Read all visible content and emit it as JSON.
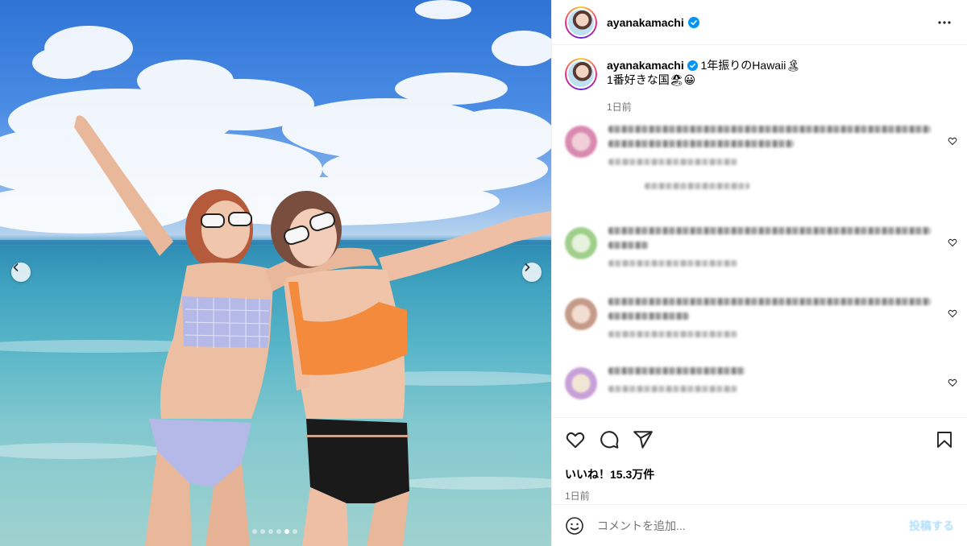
{
  "post": {
    "username": "ayanakamachi",
    "verified": true,
    "caption_line1": "1年振りのHawaii🏝",
    "caption_line2": "1番好きな国🏖😀",
    "caption_time": "1日前",
    "likes_text": "いいね！15.3万件",
    "post_time": "1日前",
    "image_alt": "Two women in bikinis and white sunglasses posing in the ocean under a blue sky with clouds",
    "carousel": {
      "count": 6,
      "active": 4
    }
  },
  "comments": [
    {
      "note": "blurred",
      "avatar_color": "#d98ab0"
    },
    {
      "note": "blurred",
      "avatar_color": "#9fcf8a"
    },
    {
      "note": "blurred",
      "avatar_color": "#c59a88"
    },
    {
      "note": "blurred",
      "avatar_color": "#c7a0d8"
    }
  ],
  "comment_box": {
    "placeholder": "コメントを追加...",
    "post_label": "投稿する"
  },
  "colors": {
    "verified_blue": "#0095f6",
    "muted_text": "#737373",
    "post_disabled": "#b2dffc"
  }
}
